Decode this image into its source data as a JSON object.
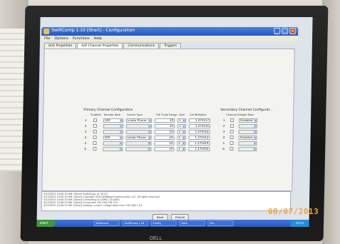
{
  "window": {
    "title": "SwiftComp 1.10 [Short] - Configuration",
    "minimize": "_",
    "maximize": "□",
    "close": "×"
  },
  "menu": [
    "File",
    "Options",
    "Functions",
    "Help"
  ],
  "tabs": [
    {
      "label": "Unit Properties"
    },
    {
      "label": "A/D Channel Properties",
      "active": true
    },
    {
      "label": "Communications"
    },
    {
      "label": "Triggers"
    }
  ],
  "primary": {
    "title": "Primary Channel Configuration",
    "headers": [
      "Enabled",
      "Transfer Rate",
      "Sensor Type",
      "Full Scale Range",
      "Gain",
      "Cal Multiplier"
    ],
    "rows": [
      {
        "num": "1",
        "rate": "500",
        "type": "Linear Phone",
        "range": "10",
        "gain": "1",
        "mult": "1.275517"
      },
      {
        "num": "2",
        "rate": "",
        "type": "",
        "range": "10",
        "gain": "1",
        "mult": "1.275516"
      },
      {
        "num": "3",
        "rate": "",
        "type": "",
        "range": "10",
        "gain": "1",
        "mult": "1.275514"
      },
      {
        "num": "4",
        "rate": "500",
        "type": "Linear Phone",
        "range": "10",
        "gain": "1",
        "mult": "1.275512"
      },
      {
        "num": "5",
        "rate": "",
        "type": "",
        "range": "10",
        "gain": "1",
        "mult": "1.275419"
      },
      {
        "num": "6",
        "rate": "",
        "type": "",
        "range": "10",
        "gain": "1",
        "mult": "1.275502"
      }
    ]
  },
  "secondary": {
    "title": "Secondary Channel Configurat...",
    "headers": [
      "Channel",
      "Sample Rate"
    ],
    "rows": [
      {
        "num": "1",
        "rate": "Disabled"
      },
      {
        "num": "2",
        "rate": ""
      },
      {
        "num": "3",
        "rate": ""
      },
      {
        "num": "4",
        "rate": "Disabled"
      },
      {
        "num": "5",
        "rate": ""
      },
      {
        "num": "6",
        "rate": ""
      }
    ]
  },
  "log": [
    "4/12/2012 10:00:53 AM: [Short] SwiftComp v1.10 [1]",
    "4/12/2012 10:00:53 AM: [Short] Copyright 2010 Wideband Instruments, LLC. All rights reserved.",
    "4/12/2012 10:00:53 AM: [Short] Connecting to COM1 (115200)",
    "4/12/2012 10:00:53 AM: [Short] Connected: SN 1361 FW 150",
    "4/12/2012 10:00:53 AM: [Short] Loading current configuration from 192.168.1.10"
  ],
  "buttons": {
    "ok": "Save",
    "cancel": "Cancel"
  },
  "taskbar": {
    "start": "start",
    "tasks": [
      "Wideband",
      "SwiftComp 1.10",
      "Config",
      "Data",
      "Pro..."
    ],
    "clock": "10:01"
  },
  "photo": {
    "date_stamp": "08/07/2013",
    "brand": "DELL"
  }
}
